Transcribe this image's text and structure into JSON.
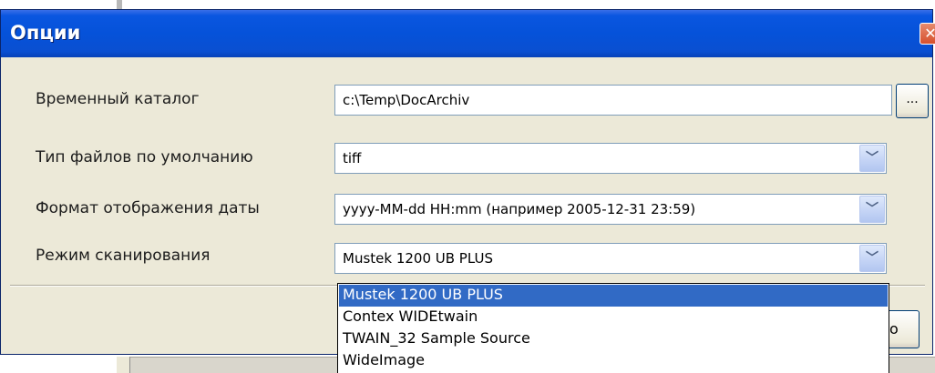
{
  "window": {
    "title": "Опции"
  },
  "close_icon_glyph": "✕",
  "form": {
    "temp_dir": {
      "label": "Временный каталог",
      "value": "c:\\Temp\\DocArchiv",
      "browse_label": "..."
    },
    "file_type": {
      "label": "Тип файлов по умолчанию",
      "value": "tiff"
    },
    "date_format": {
      "label": "Формат отображения даты",
      "value": "yyyy-MM-dd HH:mm (например 2005-12-31 23:59)"
    },
    "scan_mode": {
      "label": "Режим сканирования",
      "value": "Mustek 1200 UB PLUS",
      "options": [
        "Mustek 1200 UB PLUS",
        "Contex WIDEtwain",
        "TWAIN_32 Sample Source",
        "WideImage"
      ],
      "selected_index": 0
    }
  },
  "footer": {
    "button_partial_label": "о"
  },
  "icons": {
    "dropdown": "chevron-down-icon",
    "close": "close-icon"
  },
  "colors": {
    "titlebar": "#0552d9",
    "window_bg": "#ece9d8",
    "selection": "#316ac5",
    "field_border": "#7f9db9"
  }
}
